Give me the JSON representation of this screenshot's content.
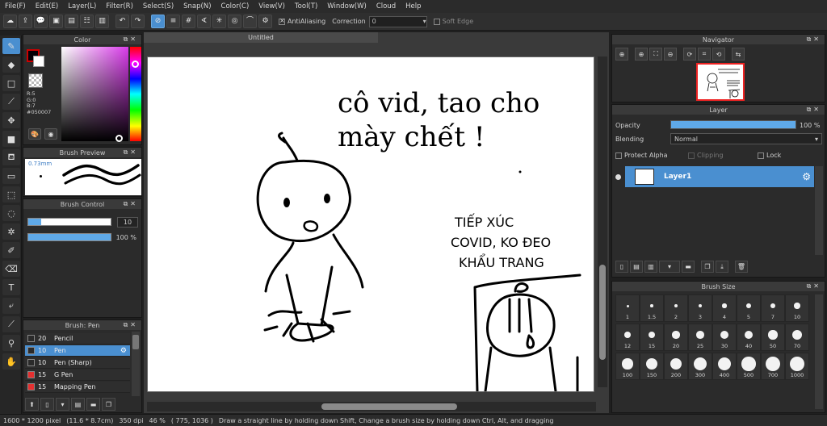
{
  "menu": [
    "File(F)",
    "Edit(E)",
    "Layer(L)",
    "Filter(R)",
    "Select(S)",
    "Snap(N)",
    "Color(C)",
    "View(V)",
    "Tool(T)",
    "Window(W)",
    "Cloud",
    "Help"
  ],
  "toolbar": {
    "antialiasing_label": "AntiAliasing",
    "correction_label": "Correction",
    "correction_value": "0",
    "soft_edge_label": "Soft Edge"
  },
  "color_panel": {
    "title": "Color",
    "r": "R:5",
    "g": "G:0",
    "b": "B:7",
    "hex": "#050007",
    "fg_color": "#050007",
    "bg_color": "#ffffff"
  },
  "brush_preview": {
    "title": "Brush Preview",
    "size": "0.73mm"
  },
  "brush_control": {
    "title": "Brush Control",
    "size_value": "10",
    "opacity_value": "100 %",
    "size_fraction": 1.0,
    "opacity_fraction": 1.0
  },
  "brush_list": {
    "title": "Brush: Pen",
    "items": [
      {
        "size": "20",
        "name": "Pencil",
        "swatch": "#2a2a2a",
        "selected": false
      },
      {
        "size": "10",
        "name": "Pen",
        "swatch": "#2a2a2a",
        "selected": true
      },
      {
        "size": "10",
        "name": "Pen (Sharp)",
        "swatch": "#2a2a2a",
        "selected": false
      },
      {
        "size": "15",
        "name": "G Pen",
        "swatch": "#e53030",
        "selected": false
      },
      {
        "size": "15",
        "name": "Mapping Pen",
        "swatch": "#e53030",
        "selected": false
      }
    ]
  },
  "canvas": {
    "tab_title": "Untitled",
    "text_top": [
      "cô vid, tao cho",
      "mày chết !"
    ],
    "text_right": [
      "TIẾP XÚC",
      "COVID, KO ĐEO",
      "KHẨU TRANG"
    ]
  },
  "navigator": {
    "title": "Navigator"
  },
  "layer_panel": {
    "title": "Layer",
    "opacity_label": "Opacity",
    "opacity_value": "100 %",
    "opacity_fraction": 1.0,
    "blending_label": "Blending",
    "blending_value": "Normal",
    "protect_alpha": "Protect Alpha",
    "clipping": "Clipping",
    "lock": "Lock",
    "layers": [
      {
        "name": "Layer1"
      }
    ]
  },
  "brush_size": {
    "title": "Brush Size",
    "sizes": [
      "1",
      "1.5",
      "2",
      "3",
      "4",
      "5",
      "7",
      "10",
      "12",
      "15",
      "20",
      "25",
      "30",
      "40",
      "50",
      "70",
      "100",
      "150",
      "200",
      "300",
      "400",
      "500",
      "700",
      "1000"
    ]
  },
  "status": {
    "dimensions": "1600 * 1200 pixel",
    "physical": "(11.6 * 8.7cm)",
    "dpi": "350 dpi",
    "zoom": "46 %",
    "coords": "( 775, 1036 )",
    "hint": "Draw a straight line by holding down Shift, Change a brush size by holding down Ctrl, Alt, and dragging"
  },
  "colors": {
    "accent": "#4a8fd0",
    "bar": "#5fa9e8"
  }
}
